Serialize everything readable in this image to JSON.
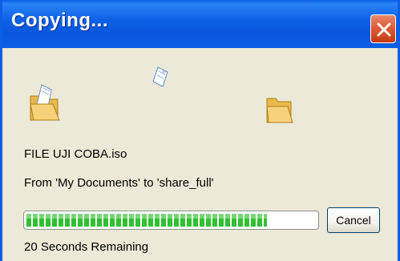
{
  "window": {
    "title": "Copying...",
    "close_icon": "close-x-icon",
    "accent": "#0a5fe3"
  },
  "animation": {
    "source_icon": "folder-with-document-icon",
    "flying_icon": "document-icon",
    "destination_icon": "folder-icon"
  },
  "copy": {
    "file_name": "FILE UJI COBA.iso",
    "from_to": "From 'My Documents' to 'share_full'",
    "progress_fraction": 0.83,
    "progress_color": "#30c030",
    "cancel_label": "Cancel",
    "time_remaining": "20 Seconds Remaining"
  }
}
